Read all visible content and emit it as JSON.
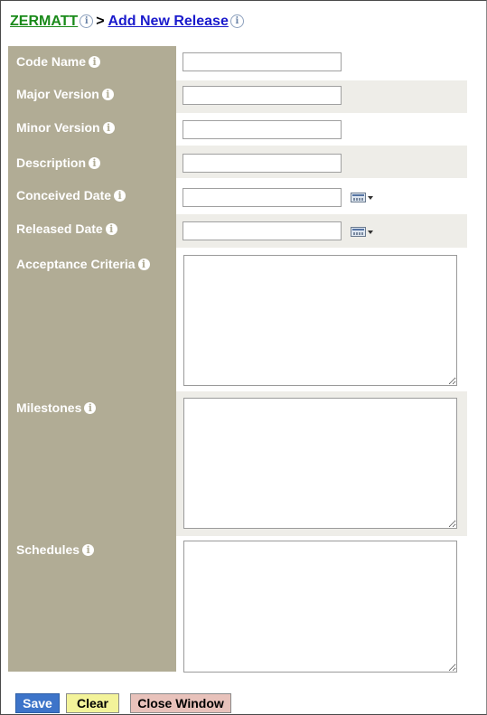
{
  "breadcrumb": {
    "project": "ZERMATT",
    "separator": ">",
    "page": "Add New Release"
  },
  "info_icon_glyph": "i",
  "fields": {
    "code_name": {
      "label": "Code Name",
      "value": ""
    },
    "major_version": {
      "label": "Major Version",
      "value": ""
    },
    "minor_version": {
      "label": "Minor Version",
      "value": ""
    },
    "description": {
      "label": "Description",
      "value": ""
    },
    "conceived_date": {
      "label": "Conceived Date",
      "value": ""
    },
    "released_date": {
      "label": "Released Date",
      "value": ""
    },
    "acceptance_criteria": {
      "label": "Acceptance Criteria",
      "value": ""
    },
    "milestones": {
      "label": "Milestones",
      "value": ""
    },
    "schedules": {
      "label": "Schedules",
      "value": ""
    }
  },
  "buttons": {
    "save": "Save",
    "clear": "Clear",
    "close": "Close Window"
  },
  "colors": {
    "label_column": "#b1ac95",
    "row_shade": "#eeede8",
    "project_link": "#1a8a1a",
    "page_link": "#1a1acc",
    "save_button": "#3d74c9",
    "clear_button": "#f3f39a",
    "close_button": "#e8c2bb"
  },
  "icons": [
    "info-icon",
    "calendar-icon"
  ]
}
